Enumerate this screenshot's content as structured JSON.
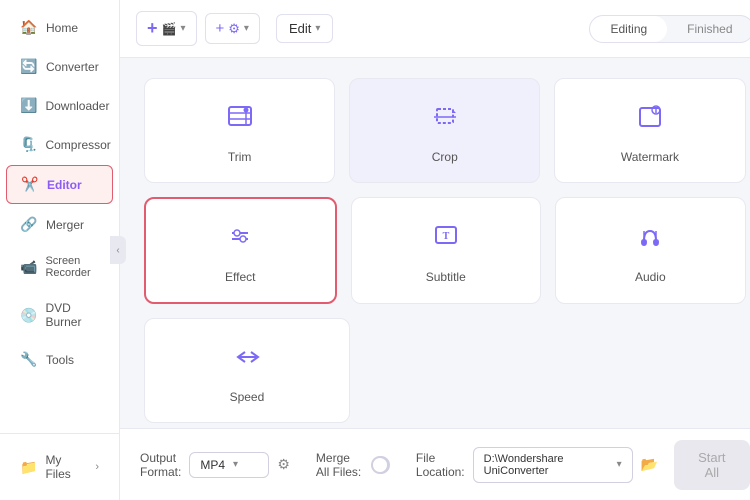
{
  "sidebar": {
    "items": [
      {
        "id": "home",
        "label": "Home",
        "icon": "🏠"
      },
      {
        "id": "converter",
        "label": "Converter",
        "icon": "🔄"
      },
      {
        "id": "downloader",
        "label": "Downloader",
        "icon": "⬇️"
      },
      {
        "id": "compressor",
        "label": "Compressor",
        "icon": "🗜️"
      },
      {
        "id": "editor",
        "label": "Editor",
        "icon": "✂️",
        "active": true
      },
      {
        "id": "merger",
        "label": "Merger",
        "icon": "🔗"
      },
      {
        "id": "screen-recorder",
        "label": "Screen Recorder",
        "icon": "📹"
      },
      {
        "id": "dvd-burner",
        "label": "DVD Burner",
        "icon": "💿"
      },
      {
        "id": "tools",
        "label": "Tools",
        "icon": "🔧"
      }
    ],
    "bottom_item": {
      "label": "My Files",
      "icon": "📁"
    }
  },
  "toolbar": {
    "add_btn_label": "",
    "refresh_btn_label": "",
    "edit_label": "Edit",
    "tabs": [
      {
        "id": "editing",
        "label": "Editing",
        "active": true
      },
      {
        "id": "finished",
        "label": "Finished"
      }
    ]
  },
  "grid": {
    "cards": [
      {
        "id": "trim",
        "label": "Trim",
        "icon": "✂",
        "row": 0,
        "selected": false
      },
      {
        "id": "crop",
        "label": "Crop",
        "icon": "⊡",
        "row": 0,
        "selected": false,
        "highlighted": true
      },
      {
        "id": "watermark",
        "label": "Watermark",
        "icon": "⊙",
        "row": 0,
        "selected": false
      },
      {
        "id": "effect",
        "label": "Effect",
        "icon": "⇌",
        "row": 1,
        "selected": true
      },
      {
        "id": "subtitle",
        "label": "Subtitle",
        "icon": "T",
        "row": 1,
        "selected": false
      },
      {
        "id": "audio",
        "label": "Audio",
        "icon": "🎧",
        "row": 1,
        "selected": false
      },
      {
        "id": "speed",
        "label": "Speed",
        "icon": "⇆",
        "row": 2,
        "selected": false
      }
    ]
  },
  "bottom": {
    "output_format_label": "Output Format:",
    "output_format_value": "MP4",
    "merge_label": "Merge All Files:",
    "file_location_label": "File Location:",
    "file_location_value": "D:\\Wondershare UniConverter",
    "start_all_label": "Start All"
  }
}
